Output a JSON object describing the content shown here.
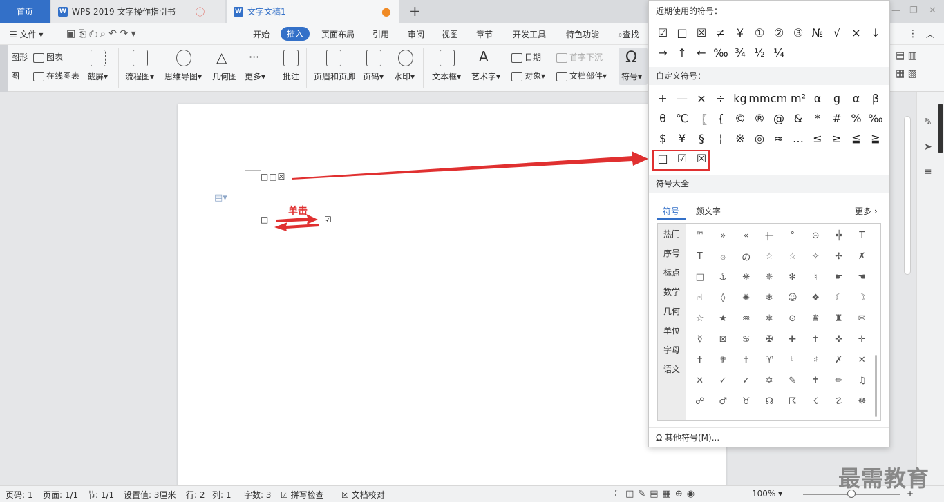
{
  "tabs": {
    "home": "首页",
    "doc1": "WPS-2019-文字操作指引书",
    "doc2": "文字文稿1",
    "new": "+"
  },
  "menu": {
    "file": "文件",
    "items": [
      "开始",
      "插入",
      "页面布局",
      "引用",
      "审阅",
      "视图",
      "章节",
      "开发工具",
      "特色功能"
    ],
    "active": "插入",
    "search": "查找"
  },
  "toolbar": {
    "shape": "图形",
    "chart": "图表",
    "img": "图",
    "online_chart": "在线图表",
    "screenshot": "截屏",
    "flowchart": "流程图",
    "mindmap": "思维导图",
    "geometry": "几何图",
    "more": "更多",
    "comment": "批注",
    "header_footer": "页眉和页脚",
    "page_num": "页码",
    "watermark": "水印",
    "textbox": "文本框",
    "wordart": "艺术字",
    "date": "日期",
    "object": "对象",
    "dropcap": "首字下沉",
    "docparts": "文档部件",
    "symbol": "符号"
  },
  "document": {
    "line1": "□□☒",
    "line2_left": "□",
    "line2_right": "☑",
    "annotation": "单击"
  },
  "dropdown": {
    "recent_title": "近期使用的符号：",
    "recent": [
      "☑",
      "□",
      "☒",
      "≠",
      "¥",
      "①",
      "②",
      "③",
      "№",
      "√",
      "×",
      "↓",
      "→",
      "↑",
      "←",
      "‰",
      "¾",
      "½",
      "¼"
    ],
    "custom_title": "自定义符号：",
    "custom": [
      "+",
      "—",
      "×",
      "÷",
      "kg",
      "mm",
      "cm",
      "m²",
      "α",
      "g",
      "α",
      "β",
      "θ",
      "℃",
      "〖",
      "{",
      "©",
      "®",
      "@",
      "&",
      "*",
      "#",
      "%",
      "‰",
      "$",
      "¥",
      "§",
      "¦",
      "※",
      "◎",
      "≈",
      "…",
      "≤",
      "≥",
      "≦",
      "≧",
      "□",
      "☑",
      "☒"
    ],
    "all_title": "符号大全",
    "tab_symbol": "符号",
    "tab_emoticon": "颜文字",
    "more": "更多",
    "categories": [
      "热门",
      "序号",
      "标点",
      "数学",
      "几何",
      "单位",
      "字母",
      "语文"
    ],
    "symbols": [
      "™",
      "»",
      "«",
      "卄",
      "°",
      "⊝",
      "╬",
      "T",
      "T",
      "۞",
      "の",
      "☆",
      "☆",
      "✧",
      "✢",
      "✗",
      "□",
      "⚓",
      "❋",
      "✵",
      "✻",
      "♮",
      "☛",
      "☚",
      "☝",
      "◊",
      "✺",
      "❄",
      "☺",
      "❖",
      "☾",
      "☽",
      "☆",
      "★",
      "♒",
      "❅",
      "⊙",
      "♛",
      "♜",
      "✉",
      "☿",
      "⊠",
      "♋",
      "✠",
      "✚",
      "✝",
      "✜",
      "✛",
      "✝",
      "✟",
      "✝",
      "♈",
      "♮",
      "♯",
      "✗",
      "✕",
      "✕",
      "✓",
      "✓",
      "✡",
      "✎",
      "✝",
      "✏",
      "♫",
      "☍",
      "♂",
      "♉",
      "☊",
      "☈",
      "☇",
      "☡",
      "☸"
    ],
    "other": "其他符号(M)..."
  },
  "status": {
    "page": "页码: 1",
    "pages": "页面: 1/1",
    "section": "节: 1/1",
    "setting": "设置值: 3厘米",
    "row": "行: 2",
    "col": "列: 1",
    "words": "字数: 3",
    "spell": "拼写检查",
    "proof": "文档校对",
    "zoom": "100%"
  },
  "watermark": "最需教育",
  "colors": {
    "accent": "#3370c8",
    "arrow": "#e03030"
  }
}
